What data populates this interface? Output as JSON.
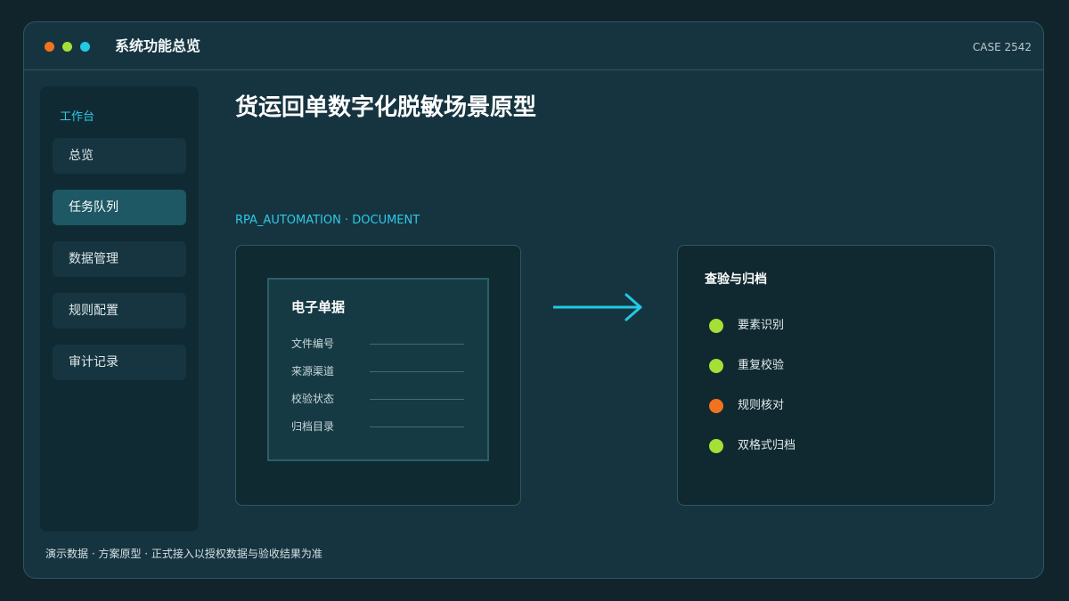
{
  "window": {
    "title": "系统功能总览",
    "case_id": "CASE 2542",
    "controls": [
      {
        "name": "close",
        "color": "#f2731e"
      },
      {
        "name": "minimize",
        "color": "#a5e036"
      },
      {
        "name": "maximize",
        "color": "#22c9e3"
      }
    ]
  },
  "sidebar": {
    "heading": "工作台",
    "items": [
      {
        "label": "总览",
        "active": false
      },
      {
        "label": "任务队列",
        "active": true
      },
      {
        "label": "数据管理",
        "active": false
      },
      {
        "label": "规则配置",
        "active": false
      },
      {
        "label": "审计记录",
        "active": false
      }
    ]
  },
  "main": {
    "title": "货运回单数字化脱敏场景原型",
    "subtitle": "RPA_AUTOMATION · DOCUMENT",
    "document_card": {
      "title": "电子单据",
      "fields": [
        "文件编号",
        "来源渠道",
        "校验状态",
        "归档目录"
      ]
    },
    "flow_arrow_icon": "arrow-right-icon",
    "check_panel": {
      "title": "查验与归档",
      "items": [
        {
          "label": "要素识别",
          "status_color": "#a5e036"
        },
        {
          "label": "重复校验",
          "status_color": "#a5e036"
        },
        {
          "label": "规则核对",
          "status_color": "#f2731e"
        },
        {
          "label": "双格式归档",
          "status_color": "#a5e036"
        }
      ]
    }
  },
  "footer": {
    "note": "演示数据 · 方案原型 · 正式接入以授权数据与验收结果为准"
  },
  "colors": {
    "accent": "#22c9e3",
    "ok": "#a5e036",
    "warn": "#f2731e"
  }
}
